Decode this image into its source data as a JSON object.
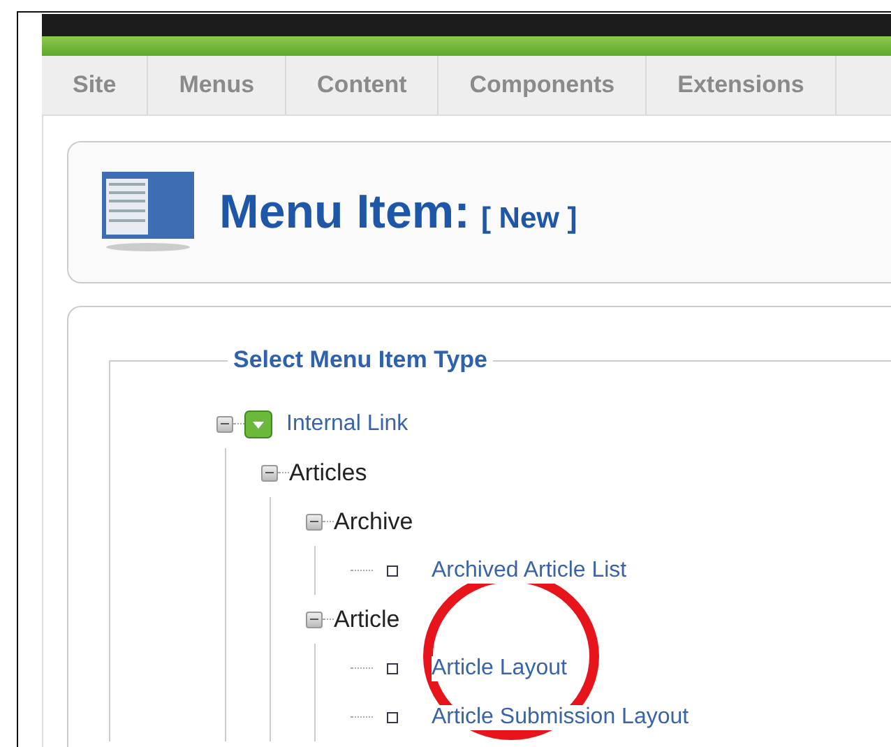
{
  "tabs": [
    {
      "label": "Site",
      "selected": false
    },
    {
      "label": "Menus",
      "selected": false
    },
    {
      "label": "Content",
      "selected": false
    },
    {
      "label": "Components",
      "selected": false
    },
    {
      "label": "Extensions",
      "selected": false
    }
  ],
  "header": {
    "title": "Menu Item:",
    "subtitle": "[ New ]"
  },
  "fieldset": {
    "legend": "Select Menu Item Type"
  },
  "tree": [
    {
      "kind": "root",
      "label": "Internal Link",
      "expanded": true,
      "children": [
        {
          "kind": "group",
          "label": "Articles",
          "expanded": true,
          "children": [
            {
              "kind": "group",
              "label": "Archive",
              "expanded": true,
              "children": [
                {
                  "kind": "leaf",
                  "label": "Archived Article List"
                }
              ]
            },
            {
              "kind": "group",
              "label": "Article",
              "expanded": true,
              "children": [
                {
                  "kind": "leaf",
                  "label": "Article Layout"
                },
                {
                  "kind": "leaf",
                  "label": "Article Submission Layout"
                }
              ]
            }
          ]
        }
      ]
    }
  ],
  "annotation": {
    "kind": "circle",
    "color": "#e8141b"
  }
}
